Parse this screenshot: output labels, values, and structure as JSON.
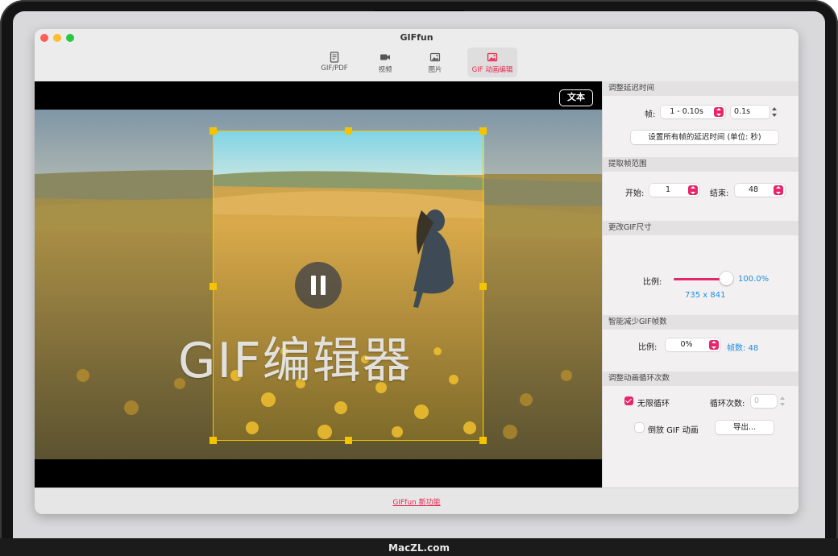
{
  "window": {
    "title": "GIFfun"
  },
  "tabs": [
    {
      "label": "GIF/PDF",
      "icon": "document-icon",
      "active": false
    },
    {
      "label": "视频",
      "icon": "video-camera-icon",
      "active": false
    },
    {
      "label": "图片",
      "icon": "image-icon",
      "active": false
    },
    {
      "label": "GIF 动画编辑",
      "icon": "gif-edit-icon",
      "active": true
    }
  ],
  "stage": {
    "text_button": "文本",
    "overlay_text": "GIF编辑器",
    "playback": "paused"
  },
  "panel": {
    "delay": {
      "title": "调整延迟时间",
      "frame_label": "帧:",
      "frame_select": "1 - 0.10s",
      "delay_value": "0.1s",
      "set_all_button": "设置所有帧的延迟时间 (单位: 秒)"
    },
    "range": {
      "title": "提取帧范围",
      "start_label": "开始:",
      "start_value": "1",
      "end_label": "结束:",
      "end_value": "48"
    },
    "size": {
      "title": "更改GIF尺寸",
      "scale_label": "比例:",
      "scale_value": "100.0%",
      "scale_fraction": 1.0,
      "dimensions": "735 x 841"
    },
    "reduce": {
      "title": "智能减少GIF帧数",
      "scale_label": "比例:",
      "scale_value": "0%",
      "frame_count": "帧数: 48"
    },
    "loop": {
      "title": "调整动画循环次数",
      "infinite_label": "无限循环",
      "infinite_checked": true,
      "count_label": "循环次数:",
      "count_value": "0",
      "reverse_label": "倒放 GIF 动画",
      "reverse_checked": false,
      "export_button": "导出..."
    }
  },
  "footer": {
    "link": "GIFfun 新功能"
  },
  "device": {
    "brand": "MacZL.com"
  },
  "colors": {
    "accent": "#e8246a",
    "link_blue": "#1b8fe3",
    "crop_handle": "#f5c400"
  }
}
